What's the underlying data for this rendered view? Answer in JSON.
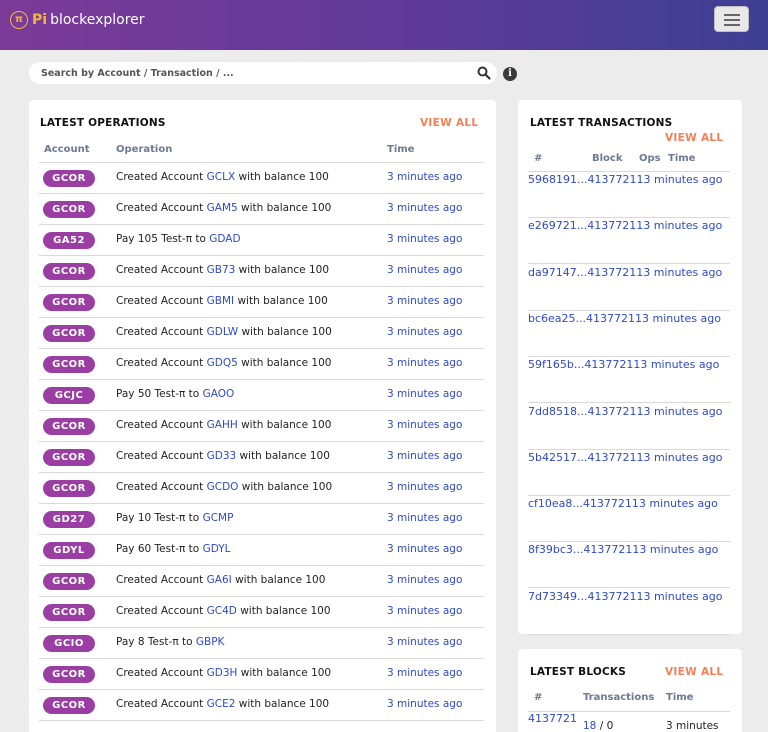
{
  "navbar": {
    "logo_glyph": "π",
    "brand_pi": "Pi",
    "brand_name": "blockexplorer",
    "menu_icon": "hamburger-icon"
  },
  "search": {
    "placeholder": "Search by Account / Transaction / ...",
    "icon": "search-icon",
    "info_icon": "info-icon"
  },
  "colors": {
    "nav_start": "#7b3a98",
    "nav_end": "#3d3f93",
    "badge": "#9b3ea4",
    "link": "#2f49c9",
    "view_all": "#f47f55"
  },
  "latest_operations": {
    "title": "LATEST OPERATIONS",
    "view_all": "VIEW ALL",
    "headers": {
      "account": "Account",
      "operation": "Operation",
      "time": "Time"
    },
    "rows": [
      {
        "account": "GCOR",
        "pre": "Created Account ",
        "link": "GCLX",
        "post": " with balance 100",
        "time": "3 minutes ago"
      },
      {
        "account": "GCOR",
        "pre": "Created Account ",
        "link": "GAM5",
        "post": " with balance 100",
        "time": "3 minutes ago"
      },
      {
        "account": "GA52",
        "pre": "Pay 105 Test-π to ",
        "link": "GDAD",
        "post": "",
        "time": "3 minutes ago"
      },
      {
        "account": "GCOR",
        "pre": "Created Account ",
        "link": "GB73",
        "post": " with balance 100",
        "time": "3 minutes ago"
      },
      {
        "account": "GCOR",
        "pre": "Created Account ",
        "link": "GBMI",
        "post": " with balance 100",
        "time": "3 minutes ago"
      },
      {
        "account": "GCOR",
        "pre": "Created Account ",
        "link": "GDLW",
        "post": " with balance 100",
        "time": "3 minutes ago"
      },
      {
        "account": "GCOR",
        "pre": "Created Account ",
        "link": "GDQ5",
        "post": " with balance 100",
        "time": "3 minutes ago"
      },
      {
        "account": "GCJC",
        "pre": "Pay 50 Test-π to ",
        "link": "GAOO",
        "post": "",
        "time": "3 minutes ago"
      },
      {
        "account": "GCOR",
        "pre": "Created Account ",
        "link": "GAHH",
        "post": " with balance 100",
        "time": "3 minutes ago"
      },
      {
        "account": "GCOR",
        "pre": "Created Account ",
        "link": "GD33",
        "post": " with balance 100",
        "time": "3 minutes ago"
      },
      {
        "account": "GCOR",
        "pre": "Created Account ",
        "link": "GCDO",
        "post": " with balance 100",
        "time": "3 minutes ago"
      },
      {
        "account": "GD27",
        "pre": "Pay 10 Test-π to ",
        "link": "GCMP",
        "post": "",
        "time": "3 minutes ago"
      },
      {
        "account": "GDYL",
        "pre": "Pay 60 Test-π to ",
        "link": "GDYL",
        "post": "",
        "time": "3 minutes ago"
      },
      {
        "account": "GCOR",
        "pre": "Created Account ",
        "link": "GA6I",
        "post": " with balance 100",
        "time": "3 minutes ago"
      },
      {
        "account": "GCOR",
        "pre": "Created Account ",
        "link": "GC4D",
        "post": " with balance 100",
        "time": "3 minutes ago"
      },
      {
        "account": "GCIO",
        "pre": "Pay 8 Test-π to ",
        "link": "GBPK",
        "post": "",
        "time": "3 minutes ago"
      },
      {
        "account": "GCOR",
        "pre": "Created Account ",
        "link": "GD3H",
        "post": " with balance 100",
        "time": "3 minutes ago"
      },
      {
        "account": "GCOR",
        "pre": "Created Account ",
        "link": "GCE2",
        "post": " with balance 100",
        "time": "3 minutes ago"
      }
    ]
  },
  "latest_transactions": {
    "title": "LATEST TRANSACTIONS",
    "view_all": "VIEW ALL",
    "headers": {
      "hash": "#",
      "block": "Block",
      "ops": "Ops",
      "time": "Time"
    },
    "rows": [
      {
        "hash": "5968191...",
        "block": "4137721",
        "ops": "1",
        "time": "3 minutes ago"
      },
      {
        "hash": "e269721...",
        "block": "4137721",
        "ops": "1",
        "time": "3 minutes ago"
      },
      {
        "hash": "da97147...",
        "block": "4137721",
        "ops": "1",
        "time": "3 minutes ago"
      },
      {
        "hash": "bc6ea25...",
        "block": "4137721",
        "ops": "1",
        "time": "3 minutes ago"
      },
      {
        "hash": "59f165b...",
        "block": "4137721",
        "ops": "1",
        "time": "3 minutes ago"
      },
      {
        "hash": "7dd8518...",
        "block": "4137721",
        "ops": "1",
        "time": "3 minutes ago"
      },
      {
        "hash": "5b42517...",
        "block": "4137721",
        "ops": "1",
        "time": "3 minutes ago"
      },
      {
        "hash": "cf10ea8...",
        "block": "4137721",
        "ops": "1",
        "time": "3 minutes ago"
      },
      {
        "hash": "8f39bc3...",
        "block": "4137721",
        "ops": "1",
        "time": "3 minutes ago"
      },
      {
        "hash": "7d73349...",
        "block": "4137721",
        "ops": "1",
        "time": "3 minutes ago"
      }
    ]
  },
  "latest_blocks": {
    "title": "LATEST BLOCKS",
    "view_all": "VIEW ALL",
    "headers": {
      "block": "#",
      "transactions": "Transactions",
      "time": "Time"
    },
    "rows": [
      {
        "block": "4137721",
        "tx_count": "18",
        "separator": " / ",
        "op_count": "0",
        "time": "3 minutes"
      }
    ]
  }
}
